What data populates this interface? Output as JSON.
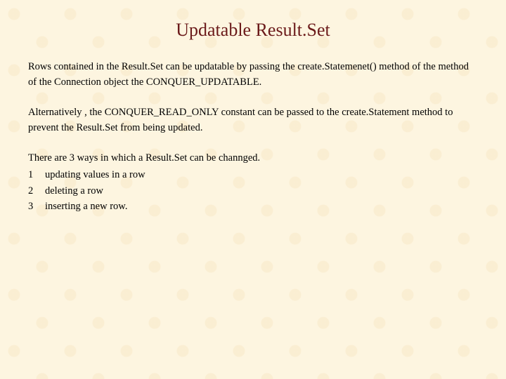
{
  "title": "Updatable Result.Set",
  "para1": "Rows contained in the Result.Set can be updatable by passing the create.Statemenet() method of the method of the Connection object the CONQUER_UPDATABLE.",
  "para2": "Alternatively , the CONQUER_READ_ONLY constant can be passed to the create.Statement method to prevent the Result.Set from being updated.",
  "list_intro": "There are 3 ways in which a Result.Set can be channged.",
  "items": [
    {
      "n": "1",
      "t": "updating values in a row"
    },
    {
      "n": "2",
      "t": "deleting a row"
    },
    {
      "n": "3",
      "t": "inserting a new row."
    }
  ]
}
